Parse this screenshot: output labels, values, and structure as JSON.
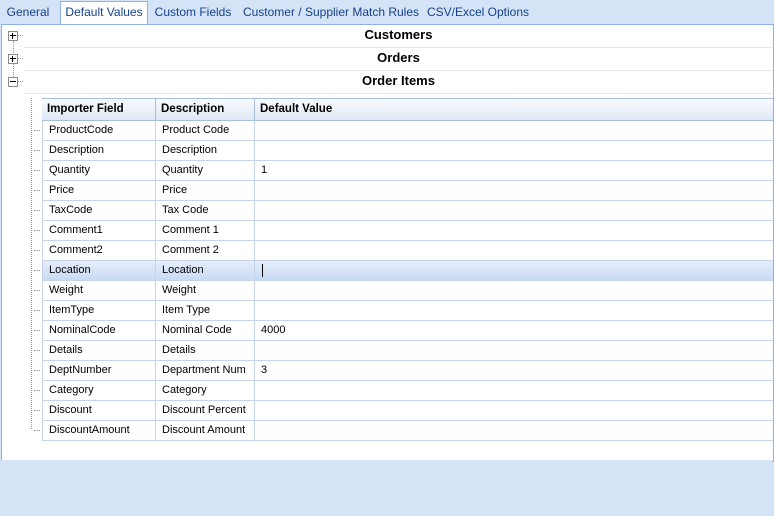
{
  "tabs": [
    {
      "label": "General",
      "active": false
    },
    {
      "label": "Default Values",
      "active": true
    },
    {
      "label": "Custom Fields",
      "active": false
    },
    {
      "label": "Customer / Supplier Match Rules",
      "active": false
    },
    {
      "label": "CSV/Excel Options",
      "active": false
    }
  ],
  "groups": [
    {
      "title": "Customers",
      "expanded": false
    },
    {
      "title": "Orders",
      "expanded": false
    },
    {
      "title": "Order Items",
      "expanded": true
    }
  ],
  "grid": {
    "columns": [
      "Importer Field",
      "Description",
      "Default Value"
    ],
    "rows": [
      {
        "field": "ProductCode",
        "description": "Product Code",
        "default": ""
      },
      {
        "field": "Description",
        "description": "Description",
        "default": ""
      },
      {
        "field": "Quantity",
        "description": "Quantity",
        "default": "1"
      },
      {
        "field": "Price",
        "description": "Price",
        "default": ""
      },
      {
        "field": "TaxCode",
        "description": "Tax Code",
        "default": ""
      },
      {
        "field": "Comment1",
        "description": "Comment 1",
        "default": ""
      },
      {
        "field": "Comment2",
        "description": "Comment 2",
        "default": ""
      },
      {
        "field": "Location",
        "description": "Location",
        "default": "",
        "selected": true
      },
      {
        "field": "Weight",
        "description": "Weight",
        "default": ""
      },
      {
        "field": "ItemType",
        "description": "Item Type",
        "default": ""
      },
      {
        "field": "NominalCode",
        "description": "Nominal Code",
        "default": "4000"
      },
      {
        "field": "Details",
        "description": "Details",
        "default": ""
      },
      {
        "field": "DeptNumber",
        "description": "Department Num",
        "default": "3"
      },
      {
        "field": "Category",
        "description": "Category",
        "default": ""
      },
      {
        "field": "Discount",
        "description": "Discount Percent",
        "default": ""
      },
      {
        "field": "DiscountAmount",
        "description": "Discount Amount",
        "default": ""
      }
    ]
  },
  "icons": {
    "collapsed": "plus-box",
    "expanded": "minus-box"
  }
}
